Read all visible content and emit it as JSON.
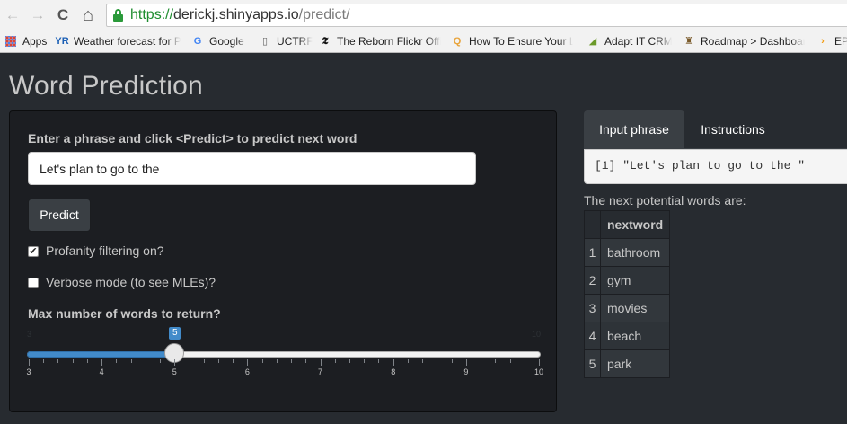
{
  "browser": {
    "url_scheme": "https://",
    "url_host": "derickj.shinyapps.io",
    "url_path": "/predict/",
    "back_glyph": "←",
    "forward_glyph": "→",
    "reload_glyph": "C",
    "home_glyph": "⌂",
    "bookmarks": [
      {
        "label": "Apps",
        "icon": "apps-grid-icon"
      },
      {
        "label": "Weather forecast for Pretoria",
        "icon": "yr-icon",
        "glyph": "YR",
        "color": "#1b5fb5"
      },
      {
        "label": "Google",
        "icon": "google-icon",
        "glyph": "G",
        "color": "#4285f4"
      },
      {
        "label": "UCTRF",
        "icon": "page-icon",
        "glyph": "▯",
        "color": "#666666"
      },
      {
        "label": "The Reborn Flickr Office",
        "icon": "nyt-icon",
        "glyph": "𝕿",
        "color": "#111111"
      },
      {
        "label": "How To Ensure Your Linux",
        "icon": "search-favicon-icon",
        "glyph": "Q",
        "color": "#e8a33a"
      },
      {
        "label": "Adapt IT CRM",
        "icon": "adaptit-icon",
        "glyph": "◢",
        "color": "#6b9a2a"
      },
      {
        "label": "Roadmap > Dashboard",
        "icon": "roadmap-icon",
        "glyph": "♜",
        "color": "#7a5a2a"
      },
      {
        "label": "EP",
        "icon": "ep-icon",
        "glyph": "›",
        "color": "#f39c12"
      }
    ]
  },
  "app": {
    "title": "Word Prediction",
    "sidebar": {
      "phrase_label": "Enter a phrase and click <Predict> to predict next word",
      "phrase_value": "Let's plan to go to the",
      "predict_label": "Predict",
      "profanity_label": "Profanity filtering on?",
      "profanity_checked": true,
      "check_glyph": "✔",
      "verbose_label": "Verbose mode (to see MLEs)?",
      "verbose_checked": false,
      "slider_label": "Max number of words to return?",
      "slider": {
        "min": 3,
        "max": 10,
        "value": 5,
        "min_label": "3",
        "max_label": "10",
        "value_label": "5",
        "tick_labels": [
          "3",
          "4",
          "5",
          "6",
          "7",
          "8",
          "9",
          "10"
        ],
        "fill_color": "#428bca"
      }
    },
    "main": {
      "tabs": [
        {
          "label": "Input phrase",
          "active": true
        },
        {
          "label": "Instructions",
          "active": false
        }
      ],
      "echo": "[1] \"Let's plan to go to the \"",
      "next_words_label": "The next potential words are:",
      "table": {
        "header": [
          "",
          "nextword"
        ],
        "rows": [
          [
            "1",
            "bathroom"
          ],
          [
            "2",
            "gym"
          ],
          [
            "3",
            "movies"
          ],
          [
            "4",
            "beach"
          ],
          [
            "5",
            "park"
          ]
        ]
      }
    }
  }
}
